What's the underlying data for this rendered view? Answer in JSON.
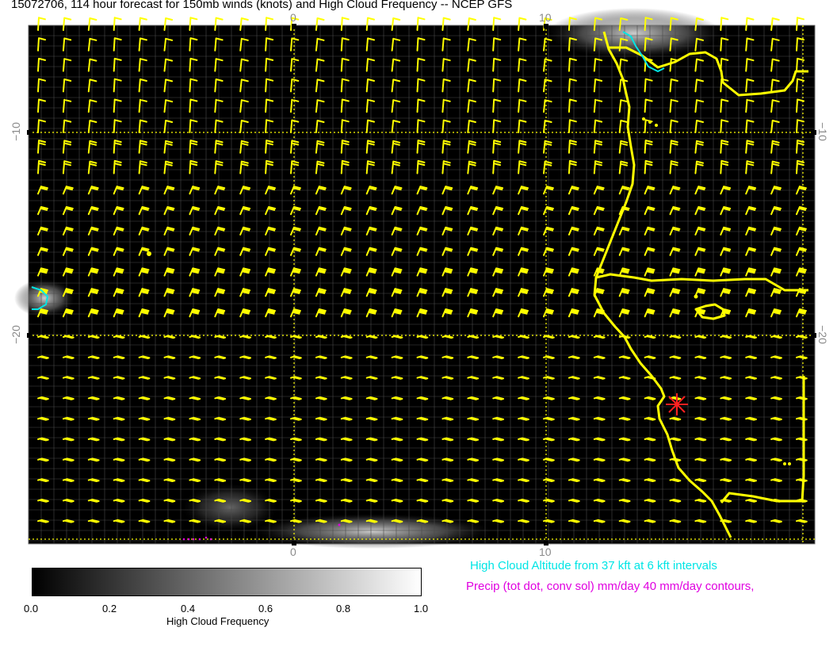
{
  "title": "15072706, 114 hour forecast for 150mb winds (knots) and High Cloud Frequency -- NCEP GFS",
  "axes": {
    "top_ticks": [
      "0",
      "10"
    ],
    "bottom_ticks": [
      "0",
      "10"
    ],
    "left_ticks": [
      "−10",
      "−20"
    ],
    "right_ticks": [
      "−10",
      "−20"
    ]
  },
  "colorbar": {
    "title": "High Cloud Frequency",
    "labels": [
      "0.0",
      "0.2",
      "0.4",
      "0.6",
      "0.8",
      "1.0"
    ],
    "values": [
      0.0,
      0.2,
      0.4,
      0.6,
      0.8,
      1.0
    ]
  },
  "legend": {
    "cloud_altitude": "High Cloud Altitude from 37 kft at 6 kft intervals",
    "precip": "Precip (tot dot, conv sol) mm/day 40 mm/day contours,"
  },
  "colors": {
    "background": "#000000",
    "wind_barbs": "#ffff00",
    "coastline": "#ffff00",
    "cloud_contour": "#00e5e5",
    "precip": "#e000e0",
    "station_marker": "#ff2020"
  },
  "icons": {
    "station_marker": "asterisk-star-icon"
  }
}
